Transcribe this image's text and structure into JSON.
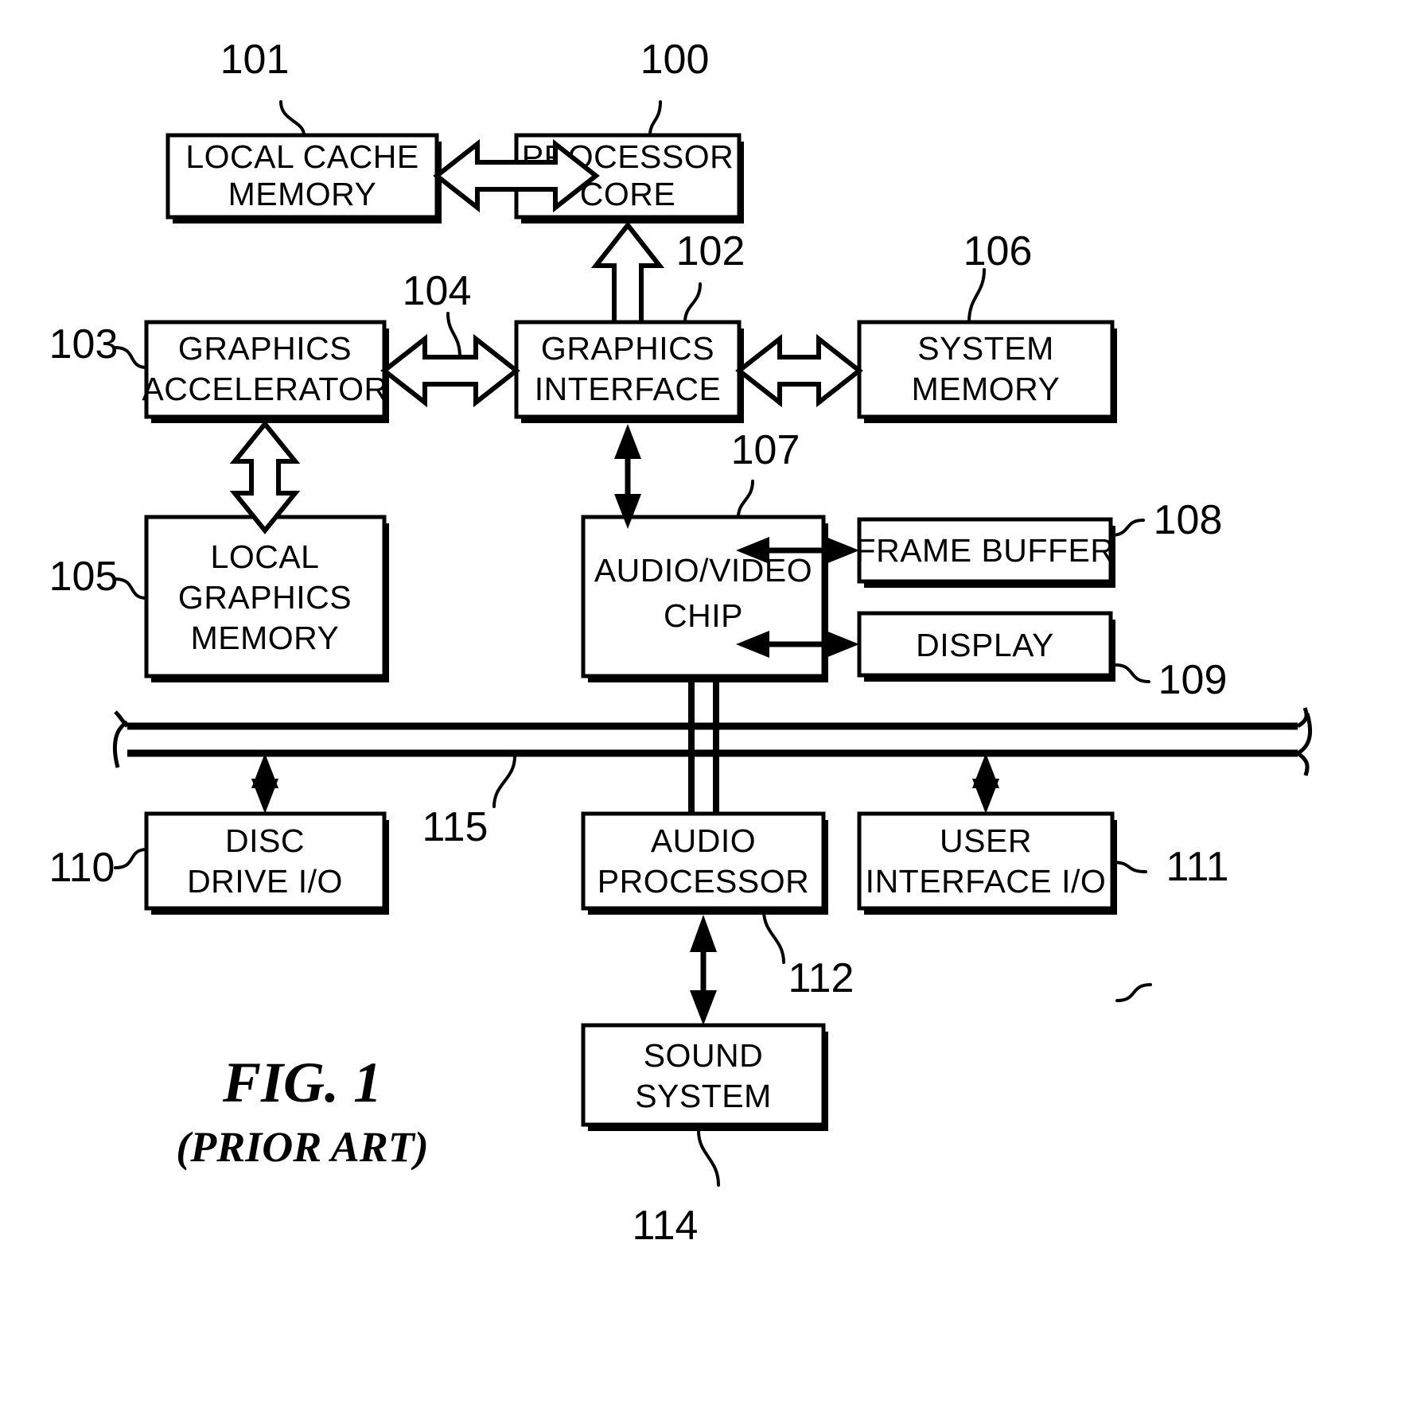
{
  "figure": {
    "caption": "FIG. 1",
    "subcaption": "(PRIOR ART)"
  },
  "diagram_data": {
    "type": "block-diagram",
    "title": "FIG. 1 (PRIOR ART)",
    "blocks": [
      {
        "ref": "101",
        "label_lines": [
          "LOCAL CACHE",
          "MEMORY"
        ]
      },
      {
        "ref": "100",
        "label_lines": [
          "PROCESSOR",
          "CORE"
        ]
      },
      {
        "ref": "103",
        "label_lines": [
          "GRAPHICS",
          "ACCELERATOR"
        ]
      },
      {
        "ref": "102",
        "label_lines": [
          "GRAPHICS",
          "INTERFACE"
        ]
      },
      {
        "ref": "106",
        "label_lines": [
          "SYSTEM",
          "MEMORY"
        ]
      },
      {
        "ref": "105",
        "label_lines": [
          "LOCAL",
          "GRAPHICS",
          "MEMORY"
        ]
      },
      {
        "ref": "107",
        "label_lines": [
          "AUDIO/VIDEO",
          "CHIP"
        ]
      },
      {
        "ref": "108",
        "label_lines": [
          "FRAME BUFFER"
        ]
      },
      {
        "ref": "109",
        "label_lines": [
          "DISPLAY"
        ]
      },
      {
        "ref": "110",
        "label_lines": [
          "DISC",
          "DRIVE I/O"
        ]
      },
      {
        "ref": "112",
        "label_lines": [
          "AUDIO",
          "PROCESSOR"
        ]
      },
      {
        "ref": "111",
        "label_lines": [
          "USER",
          "INTERFACE I/O"
        ]
      },
      {
        "ref": "114",
        "label_lines": [
          "SOUND",
          "SYSTEM"
        ]
      }
    ],
    "bus": {
      "ref": "115",
      "label": "115"
    },
    "connections": [
      {
        "from": "101",
        "to": "100",
        "style": "block-double"
      },
      {
        "from": "100",
        "to": "102",
        "style": "block-double"
      },
      {
        "from": "103",
        "to": "102",
        "style": "block-double",
        "ref": "104"
      },
      {
        "from": "102",
        "to": "106",
        "style": "block-double"
      },
      {
        "from": "103",
        "to": "105",
        "style": "block-double"
      },
      {
        "from": "102",
        "to": "107",
        "style": "thin-double"
      },
      {
        "from": "107",
        "to": "108",
        "style": "thin-double"
      },
      {
        "from": "107",
        "to": "109",
        "style": "thin-double"
      },
      {
        "from": "115",
        "to": "110",
        "style": "thin-double"
      },
      {
        "from": "115",
        "to": "111",
        "style": "thin-double"
      },
      {
        "from": "107",
        "to": "112",
        "style": "bus-cross"
      },
      {
        "from": "112",
        "to": "114",
        "style": "thin-double"
      }
    ]
  },
  "labels": {
    "b101_l1": "LOCAL CACHE",
    "b101_l2": "MEMORY",
    "b100_l1": "PROCESSOR",
    "b100_l2": "CORE",
    "b103_l1": "GRAPHICS",
    "b103_l2": "ACCELERATOR",
    "b102_l1": "GRAPHICS",
    "b102_l2": "INTERFACE",
    "b106_l1": "SYSTEM",
    "b106_l2": "MEMORY",
    "b105_l1": "LOCAL",
    "b105_l2": "GRAPHICS",
    "b105_l3": "MEMORY",
    "b107_l1": "AUDIO/VIDEO",
    "b107_l2": "CHIP",
    "b108_l1": "FRAME BUFFER",
    "b109_l1": "DISPLAY",
    "b110_l1": "DISC",
    "b110_l2": "DRIVE I/O",
    "b112_l1": "AUDIO",
    "b112_l2": "PROCESSOR",
    "b111_l1": "USER",
    "b111_l2": "INTERFACE I/O",
    "b114_l1": "SOUND",
    "b114_l2": "SYSTEM"
  },
  "refs": {
    "r100": "100",
    "r101": "101",
    "r102": "102",
    "r103": "103",
    "r104": "104",
    "r105": "105",
    "r106": "106",
    "r107": "107",
    "r108": "108",
    "r109": "109",
    "r110": "110",
    "r111": "111",
    "r112": "112",
    "r114": "114",
    "r115": "115"
  },
  "colors": {
    "ink": "#000000",
    "paper": "#ffffff"
  }
}
